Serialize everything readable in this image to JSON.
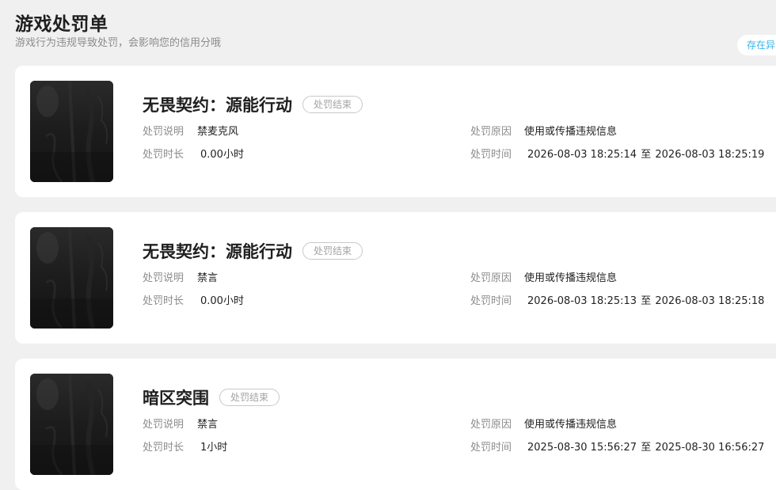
{
  "page": {
    "title": "游戏处罚单",
    "subtitle": "游戏行为违规导致处罚，会影响您的信用分哦",
    "notice_label": "存在异"
  },
  "labels": {
    "description": "处罚说明",
    "duration": "处罚时长",
    "reason": "处罚原因",
    "time": "处罚时间",
    "to": "至"
  },
  "penalties": [
    {
      "game": "无畏契约：源能行动",
      "status": "处罚结束",
      "description": "禁麦克风",
      "duration": "0.00小时",
      "reason": "使用或传播违规信息",
      "start": "2026-08-03 18:25:14",
      "end": "2026-08-03 18:25:19"
    },
    {
      "game": "无畏契约：源能行动",
      "status": "处罚结束",
      "description": "禁言",
      "duration": "0.00小时",
      "reason": "使用或传播违规信息",
      "start": "2026-08-03 18:25:13",
      "end": "2026-08-03 18:25:18"
    },
    {
      "game": "暗区突围",
      "status": "处罚结束",
      "description": "禁言",
      "duration": "1小时",
      "reason": "使用或传播违规信息",
      "start": "2025-08-30 15:56:27",
      "end": "2025-08-30 16:56:27"
    }
  ]
}
